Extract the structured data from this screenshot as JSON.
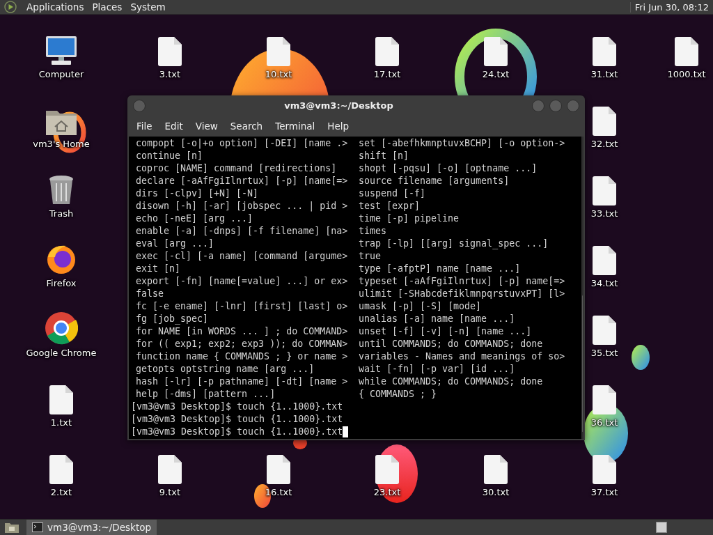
{
  "top_panel": {
    "menus": [
      "Applications",
      "Places",
      "System"
    ],
    "clock": "Fri Jun 30, 08:12"
  },
  "desktop": {
    "columns": [
      {
        "top": [
          {
            "kind": "computer",
            "label": "Computer"
          },
          {
            "kind": "home",
            "label": "vm3's Home"
          },
          {
            "kind": "trash",
            "label": "Trash"
          },
          {
            "kind": "firefox",
            "label": "Firefox"
          },
          {
            "kind": "chrome",
            "label": "Google Chrome"
          },
          {
            "kind": "file",
            "label": "1.txt"
          },
          {
            "kind": "file",
            "label": "2.txt"
          }
        ]
      },
      {
        "top": [
          {
            "kind": "file",
            "label": "3.txt"
          }
        ],
        "bottom": [
          {
            "kind": "file",
            "label": "9.txt"
          }
        ]
      },
      {
        "top": [
          {
            "kind": "file",
            "label": "10.txt"
          }
        ],
        "bottom": [
          {
            "kind": "file",
            "label": "16.txt"
          }
        ]
      },
      {
        "top": [
          {
            "kind": "file",
            "label": "17.txt"
          }
        ],
        "bottom": [
          {
            "kind": "file",
            "label": "23.txt"
          }
        ]
      },
      {
        "top": [
          {
            "kind": "file",
            "label": "24.txt"
          }
        ],
        "bottom": [
          {
            "kind": "file",
            "label": "30.txt"
          }
        ]
      },
      {
        "top": [
          {
            "kind": "file",
            "label": "31.txt"
          },
          {
            "kind": "file",
            "label": "32.txt"
          },
          {
            "kind": "file",
            "label": "33.txt"
          },
          {
            "kind": "file",
            "label": "34.txt"
          },
          {
            "kind": "file",
            "label": "35.txt"
          },
          {
            "kind": "file",
            "label": "36.txt"
          },
          {
            "kind": "file",
            "label": "37.txt"
          }
        ]
      },
      {
        "top": [
          {
            "kind": "file",
            "label": "1000.txt"
          }
        ]
      }
    ]
  },
  "terminal": {
    "title": "vm3@vm3:~/Desktop",
    "menu": [
      "File",
      "Edit",
      "View",
      "Search",
      "Terminal",
      "Help"
    ],
    "column_left": [
      "compopt [-o|+o option] [-DEI] [name .>",
      "continue [n]",
      "coproc [NAME] command [redirections]",
      "declare [-aAfFgiIlnrtux] [-p] [name[=>",
      "dirs [-clpv] [+N] [-N]",
      "disown [-h] [-ar] [jobspec ... | pid >",
      "echo [-neE] [arg ...]",
      "enable [-a] [-dnps] [-f filename] [na>",
      "eval [arg ...]",
      "exec [-cl] [-a name] [command [argume>",
      "exit [n]",
      "export [-fn] [name[=value] ...] or ex>",
      "false",
      "fc [-e ename] [-lnr] [first] [last] o>",
      "fg [job_spec]",
      "for NAME [in WORDS ... ] ; do COMMAND>",
      "for (( exp1; exp2; exp3 )); do COMMAN>",
      "function name { COMMANDS ; } or name >",
      "getopts optstring name [arg ...]",
      "hash [-lr] [-p pathname] [-dt] [name >",
      "help [-dms] [pattern ...]"
    ],
    "column_right": [
      "set [-abefhkmnptuvxBCHP] [-o option->",
      "shift [n]",
      "shopt [-pqsu] [-o] [optname ...]",
      "source filename [arguments]",
      "suspend [-f]",
      "test [expr]",
      "time [-p] pipeline",
      "times",
      "trap [-lp] [[arg] signal_spec ...]",
      "true",
      "type [-afptP] name [name ...]",
      "typeset [-aAfFgiIlnrtux] [-p] name[=>",
      "ulimit [-SHabcdefiklmnpqrstuvxPT] [l>",
      "umask [-p] [-S] [mode]",
      "unalias [-a] name [name ...]",
      "unset [-f] [-v] [-n] [name ...]",
      "until COMMANDS; do COMMANDS; done",
      "variables - Names and meanings of so>",
      "wait [-fn] [-p var] [id ...]",
      "while COMMANDS; do COMMANDS; done",
      "{ COMMANDS ; }"
    ],
    "prompts": [
      "[vm3@vm3 Desktop]$ touch {1..1000}.txt",
      "[vm3@vm3 Desktop]$ touch {1..1000}.txt",
      "[vm3@vm3 Desktop]$ touch {1..1000}.txt"
    ]
  },
  "bottom_panel": {
    "tasks": [
      {
        "label": "vm3@vm3:~/Desktop",
        "selected": true
      }
    ]
  }
}
